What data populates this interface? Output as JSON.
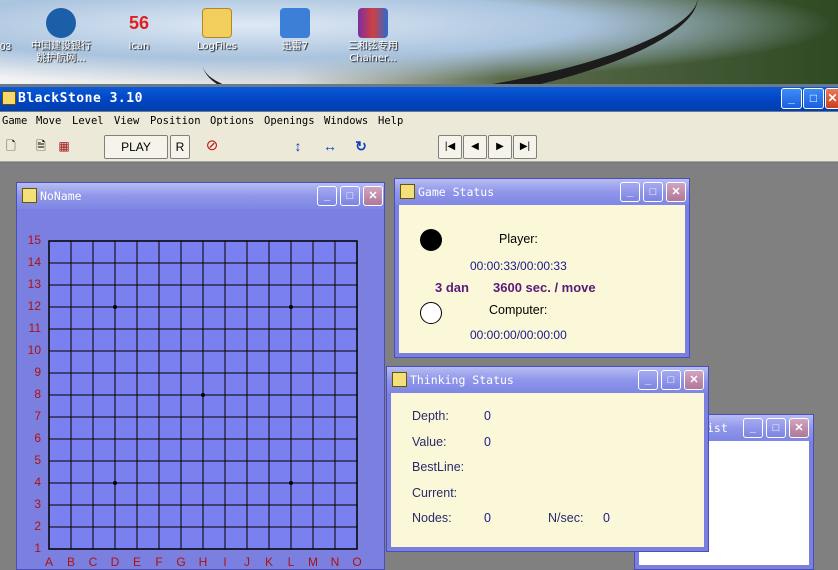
{
  "desktop": {
    "icons": [
      {
        "label": "中国建设银行\n跳护航网...",
        "name": "ccb-icon"
      },
      {
        "label": "ican",
        "name": "ican-icon"
      },
      {
        "label": "LogFiles",
        "name": "folder-icon"
      },
      {
        "label": "迅雷7",
        "name": "xunlei-icon"
      },
      {
        "label": "三和弦专用\nChainer...",
        "name": "archive-icon"
      }
    ],
    "partial_label": "03"
  },
  "app": {
    "title": "BlackStone 3.10",
    "menu": [
      "Game",
      "Move",
      "Level",
      "View",
      "Position",
      "Options",
      "Openings",
      "Windows",
      "Help"
    ],
    "toolbar": {
      "play": "PLAY",
      "r": "R",
      "first": "|◀",
      "prev": "◀",
      "next": "▶",
      "last": "▶|"
    }
  },
  "board_window": {
    "title": "NoName",
    "rows": [
      "15",
      "14",
      "13",
      "12",
      "11",
      "10",
      "9",
      "8",
      "7",
      "6",
      "5",
      "4",
      "3",
      "2",
      "1"
    ],
    "cols": [
      "A",
      "B",
      "C",
      "D",
      "E",
      "F",
      "G",
      "H",
      "I",
      "J",
      "K",
      "L",
      "M",
      "N",
      "O"
    ]
  },
  "game_status": {
    "title": "Game Status",
    "player_label": "Player:",
    "player_time": "00:00:33/00:00:33",
    "level": "3 dan",
    "time_control": "3600 sec. / move",
    "computer_label": "Computer:",
    "computer_time": "00:00:00/00:00:00"
  },
  "thinking_status": {
    "title": "Thinking Status",
    "depth_label": "Depth:",
    "depth": "0",
    "value_label": "Value:",
    "value": "0",
    "bestline_label": "BestLine:",
    "current_label": "Current:",
    "nodes_label": "Nodes:",
    "nodes": "0",
    "nsec_label": "N/sec:",
    "nsec": "0"
  },
  "list_window": {
    "title_fragment": "ist"
  }
}
